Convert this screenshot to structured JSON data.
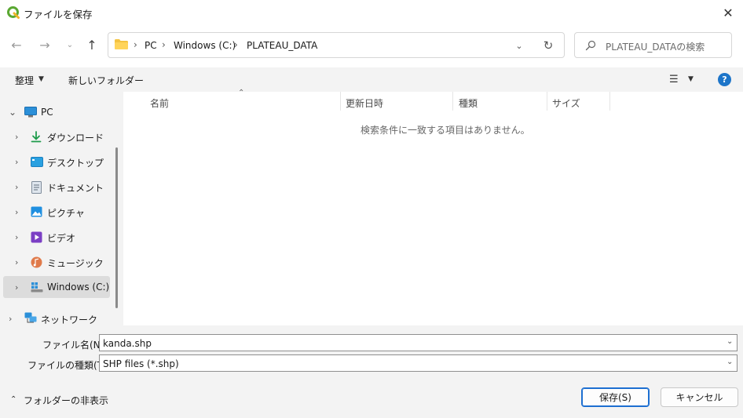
{
  "window": {
    "title": "ファイルを保存"
  },
  "address": {
    "crumbs": [
      "PC",
      "Windows (C:)",
      "PLATEAU_DATA"
    ]
  },
  "search": {
    "placeholder": "PLATEAU_DATAの検索"
  },
  "toolbar": {
    "organize_label": "整理",
    "new_folder_label": "新しいフォルダー"
  },
  "nav": {
    "items": [
      {
        "label": "PC",
        "icon": "pc-icon"
      },
      {
        "label": "ダウンロード",
        "icon": "download-icon"
      },
      {
        "label": "デスクトップ",
        "icon": "desktop-icon"
      },
      {
        "label": "ドキュメント",
        "icon": "document-icon"
      },
      {
        "label": "ピクチャ",
        "icon": "picture-icon"
      },
      {
        "label": "ビデオ",
        "icon": "video-icon"
      },
      {
        "label": "ミュージック",
        "icon": "music-icon"
      },
      {
        "label": "Windows (C:)",
        "icon": "drive-icon",
        "selected": true
      },
      {
        "label": "ネットワーク",
        "icon": "network-icon"
      }
    ]
  },
  "columns": [
    "名前",
    "更新日時",
    "種類",
    "サイズ"
  ],
  "empty_message": "検索条件に一致する項目はありません。",
  "filename": {
    "label": "ファイル名(N):",
    "value": "kanda.shp"
  },
  "filetype": {
    "label": "ファイルの種類(T):",
    "value": "SHP files (*.shp)"
  },
  "footer": {
    "hide_folders_label": "フォルダーの非表示",
    "save_label": "保存(S)",
    "cancel_label": "キャンセル"
  },
  "colors": {
    "accent": "#1d6fd1",
    "selected_bg": "#dcdcdc",
    "pane_bg": "#f3f3f3"
  }
}
